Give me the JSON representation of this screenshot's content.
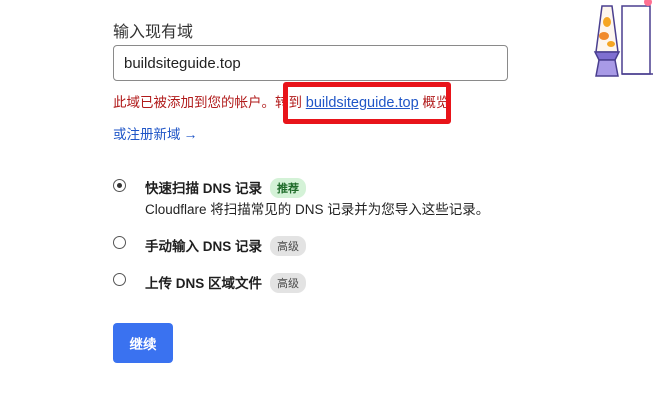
{
  "form": {
    "label": "输入现有域",
    "input_value": "buildsiteguide.top"
  },
  "error": {
    "prefix": "此域已被添加到您的帐户。转到",
    "link_text": "buildsiteguide.top",
    "suffix": "概览"
  },
  "register_link": {
    "label": "或注册新域",
    "arrow": "→"
  },
  "options": [
    {
      "title": "快速扫描 DNS 记录",
      "badge": "推荐",
      "description": "Cloudflare 将扫描常见的 DNS 记录并为您导入这些记录。",
      "selected": true
    },
    {
      "title": "手动输入 DNS 记录",
      "badge": "高级",
      "selected": false
    },
    {
      "title": "上传 DNS 区域文件",
      "badge": "高级",
      "selected": false
    }
  ],
  "continue_label": "继续",
  "colors": {
    "accent": "#3a72f0",
    "error": "#b11b1b",
    "link": "#2056c7",
    "highlight": "#e8141a",
    "badge_green": "#d4f2d7",
    "badge_gray": "#e3e3e3"
  }
}
